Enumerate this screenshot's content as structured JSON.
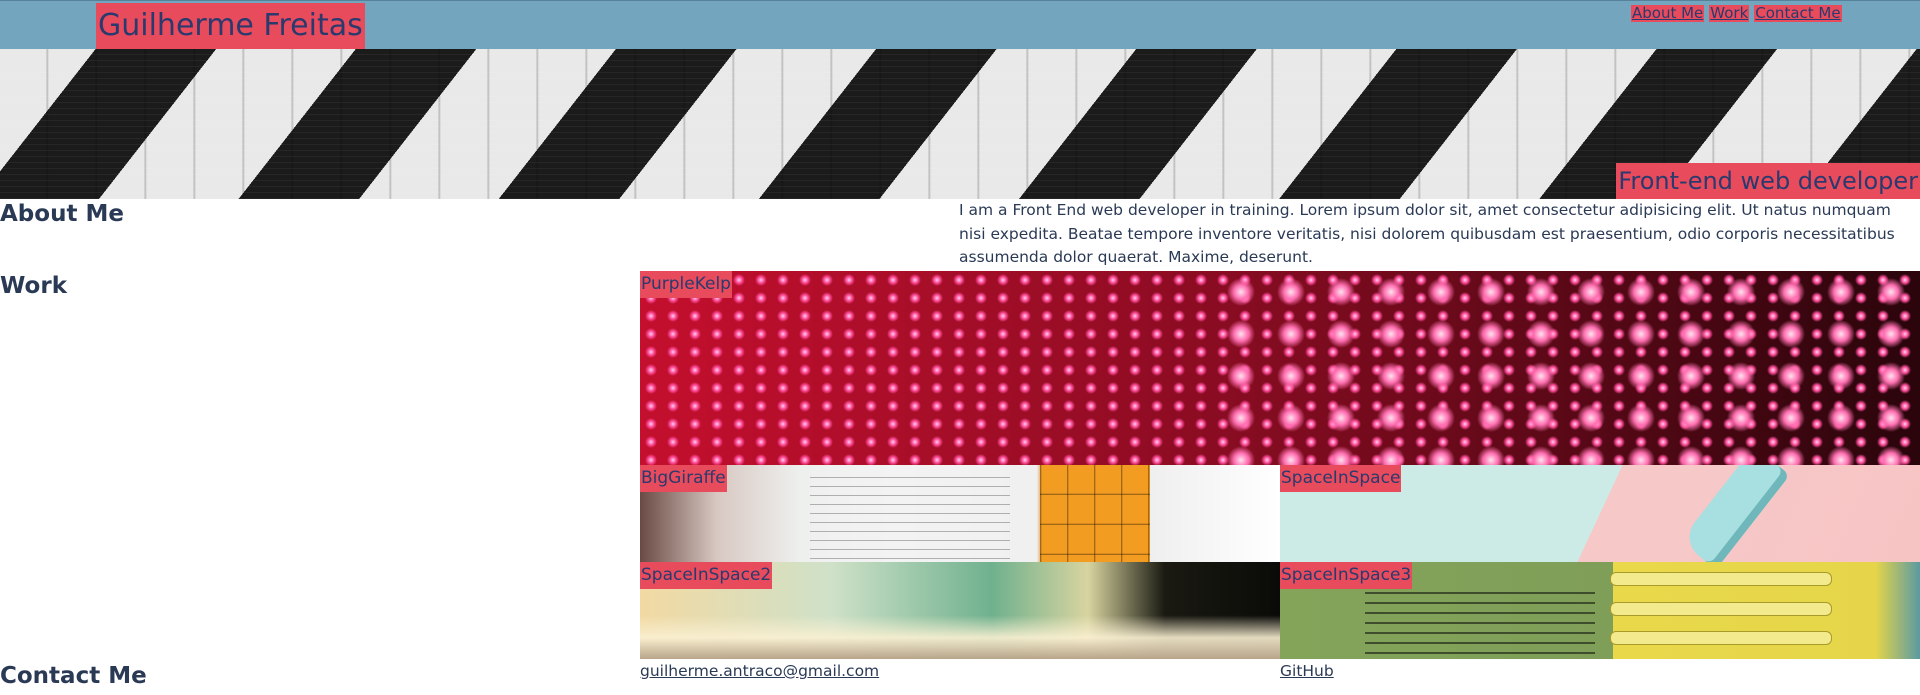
{
  "header": {
    "brand": "Guilherme Freitas",
    "nav": [
      "About Me",
      "Work",
      "Contact Me"
    ]
  },
  "hero": {
    "tagline": "Front-end web developer"
  },
  "about": {
    "title": "About Me",
    "text": "I am a Front End web developer in training. Lorem ipsum dolor sit, amet consectetur adipisicing elit. Ut natus numquam nisi expedita. Beatae tempore inventore veritatis, nisi dolorem quibusdam est praesentium, odio corporis necessitatibus assumenda dolor quaerat. Maxime, deserunt."
  },
  "work": {
    "title": "Work",
    "projects": [
      "PurpleKelp",
      "BigGiraffe",
      "SpaceInSpace",
      "SpaceInSpace2",
      "SpaceInSpace3"
    ]
  },
  "contact": {
    "title": "Contact Me",
    "email": "guilherme.antraco@gmail.com",
    "github": "GitHub"
  },
  "colors": {
    "header_bg": "#73a5bf",
    "accent": "#e84b5c",
    "text": "#2a3a55"
  }
}
